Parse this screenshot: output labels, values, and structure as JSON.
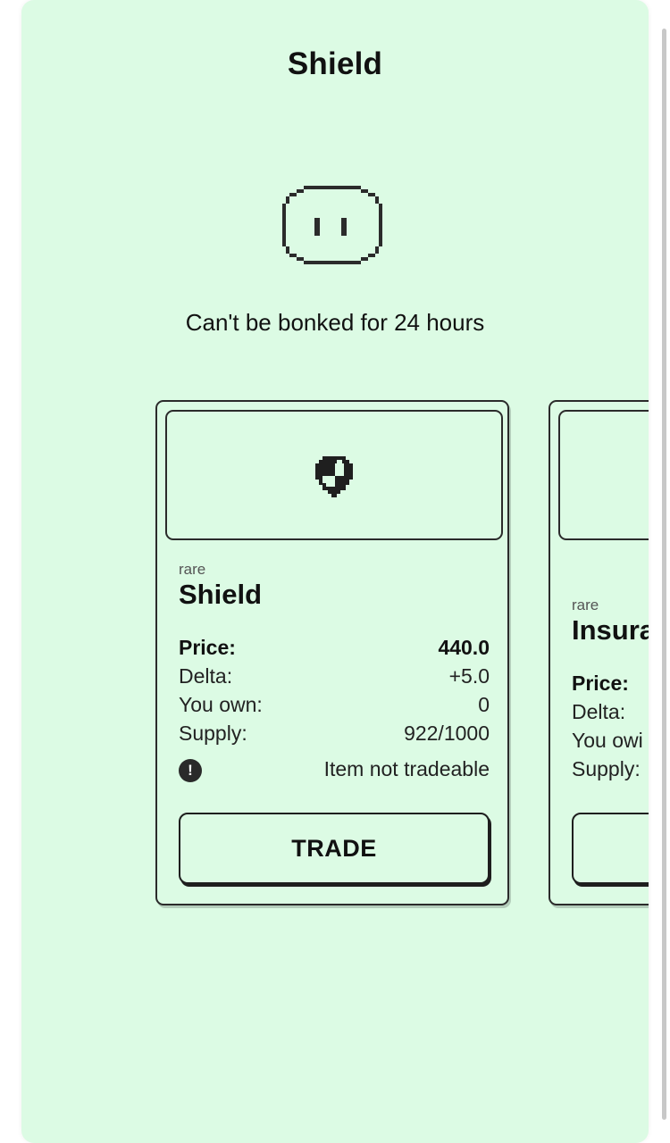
{
  "page": {
    "title": "Shield",
    "description": "Can't be bonked for 24 hours",
    "hero_icon": "pixel-face-icon"
  },
  "cards": [
    {
      "icon": "pixel-shield-icon",
      "rarity": "rare",
      "name": "Shield",
      "price_label": "Price:",
      "price_value": "440.0",
      "delta_label": "Delta:",
      "delta_value": "+5.0",
      "own_label": "You own:",
      "own_value": "0",
      "supply_label": "Supply:",
      "supply_value": "922/1000",
      "notice_icon": "exclamation-icon",
      "notice_icon_glyph": "!",
      "notice_text": "Item not tradeable",
      "trade_label": "TRADE"
    },
    {
      "rarity": "rare",
      "name": "Insura",
      "price_label": "Price:",
      "delta_label": "Delta:",
      "own_label": "You owi",
      "supply_label": "Supply:"
    }
  ],
  "colors": {
    "background": "#dcfbe4",
    "ink": "#2b2b2b"
  }
}
